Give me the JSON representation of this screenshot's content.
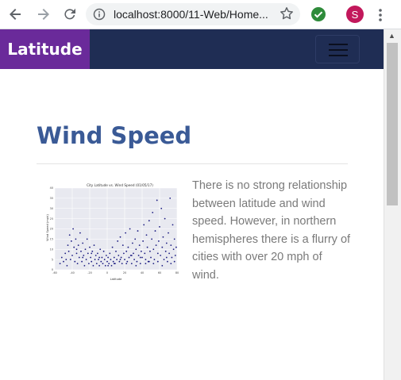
{
  "browser": {
    "url": "localhost:8000/11-Web/Home...",
    "avatar_letter": "S",
    "icons": [
      "back-arrow-icon",
      "forward-arrow-icon",
      "reload-icon",
      "info-icon",
      "star-icon",
      "check-extension-icon",
      "kebab-menu-icon"
    ]
  },
  "navbar": {
    "brand": "Latitude",
    "brand_color": "#6a2a9a",
    "background_color": "#1f2d54"
  },
  "main": {
    "title": "Wind Speed",
    "title_color": "#3a5a96",
    "description": "There is no strong relationship between latitude and wind speed. However, in northern hemispheres there is a flurry of cities with over 20 mph of wind."
  },
  "chart_data": {
    "type": "scatter",
    "title": "City Latitude vs. Wind Speed (01/05/17)",
    "xlabel": "Latitude",
    "ylabel": "Wind Speed (mph)",
    "xlim": [
      -60,
      80
    ],
    "ylim": [
      0,
      40
    ],
    "xticks": [
      "-60",
      "-40",
      "-20",
      "0",
      "20",
      "40",
      "60",
      "80"
    ],
    "yticks": [
      "0",
      "5",
      "10",
      "15",
      "20",
      "25",
      "30",
      "35",
      "40"
    ],
    "grid": true,
    "point_color": "#1a1a80",
    "series": [
      {
        "points": [
          [
            -54,
            3
          ],
          [
            -52,
            6
          ],
          [
            -50,
            4
          ],
          [
            -48,
            8
          ],
          [
            -46,
            2
          ],
          [
            -45,
            12
          ],
          [
            -44,
            9
          ],
          [
            -43,
            17
          ],
          [
            -42,
            5
          ],
          [
            -41,
            14
          ],
          [
            -40,
            7
          ],
          [
            -39,
            20
          ],
          [
            -38,
            11
          ],
          [
            -37,
            4
          ],
          [
            -36,
            15
          ],
          [
            -35,
            8
          ],
          [
            -34,
            3
          ],
          [
            -33,
            12
          ],
          [
            -32,
            6
          ],
          [
            -31,
            18
          ],
          [
            -30,
            9
          ],
          [
            -29,
            4
          ],
          [
            -28,
            13
          ],
          [
            -27,
            7
          ],
          [
            -26,
            2
          ],
          [
            -25,
            10
          ],
          [
            -24,
            5
          ],
          [
            -23,
            15
          ],
          [
            -22,
            8
          ],
          [
            -21,
            3
          ],
          [
            -20,
            11
          ],
          [
            -19,
            6
          ],
          [
            -18,
            4
          ],
          [
            -17,
            9
          ],
          [
            -16,
            2
          ],
          [
            -15,
            12
          ],
          [
            -14,
            5
          ],
          [
            -13,
            7
          ],
          [
            -12,
            3
          ],
          [
            -11,
            8
          ],
          [
            -10,
            5
          ],
          [
            -9,
            2
          ],
          [
            -8,
            10
          ],
          [
            -7,
            4
          ],
          [
            -6,
            6
          ],
          [
            -5,
            3
          ],
          [
            -4,
            9
          ],
          [
            -3,
            5
          ],
          [
            -2,
            2
          ],
          [
            -1,
            7
          ],
          [
            0,
            4
          ],
          [
            1,
            6
          ],
          [
            2,
            3
          ],
          [
            3,
            8
          ],
          [
            4,
            5
          ],
          [
            5,
            2
          ],
          [
            6,
            11
          ],
          [
            7,
            4
          ],
          [
            8,
            6
          ],
          [
            9,
            3
          ],
          [
            10,
            9
          ],
          [
            11,
            5
          ],
          [
            12,
            14
          ],
          [
            13,
            7
          ],
          [
            14,
            4
          ],
          [
            15,
            16
          ],
          [
            16,
            6
          ],
          [
            17,
            3
          ],
          [
            18,
            12
          ],
          [
            19,
            8
          ],
          [
            20,
            5
          ],
          [
            21,
            18
          ],
          [
            22,
            9
          ],
          [
            23,
            4
          ],
          [
            24,
            11
          ],
          [
            25,
            6
          ],
          [
            26,
            20
          ],
          [
            27,
            7
          ],
          [
            28,
            3
          ],
          [
            29,
            13
          ],
          [
            30,
            8
          ],
          [
            31,
            5
          ],
          [
            32,
            15
          ],
          [
            33,
            10
          ],
          [
            34,
            4
          ],
          [
            35,
            19
          ],
          [
            36,
            7
          ],
          [
            37,
            12
          ],
          [
            38,
            3
          ],
          [
            39,
            9
          ],
          [
            40,
            6
          ],
          [
            41,
            14
          ],
          [
            42,
            22
          ],
          [
            43,
            8
          ],
          [
            44,
            5
          ],
          [
            45,
            17
          ],
          [
            46,
            11
          ],
          [
            47,
            4
          ],
          [
            48,
            24
          ],
          [
            49,
            9
          ],
          [
            50,
            6
          ],
          [
            51,
            15
          ],
          [
            52,
            28
          ],
          [
            53,
            10
          ],
          [
            54,
            5
          ],
          [
            55,
            19
          ],
          [
            56,
            12
          ],
          [
            57,
            34
          ],
          [
            58,
            8
          ],
          [
            59,
            14
          ],
          [
            60,
            21
          ],
          [
            61,
            7
          ],
          [
            62,
            30
          ],
          [
            63,
            11
          ],
          [
            64,
            16
          ],
          [
            65,
            5
          ],
          [
            66,
            25
          ],
          [
            67,
            9
          ],
          [
            68,
            13
          ],
          [
            69,
            4
          ],
          [
            70,
            18
          ],
          [
            71,
            8
          ],
          [
            72,
            35
          ],
          [
            73,
            12
          ],
          [
            74,
            6
          ],
          [
            75,
            22
          ],
          [
            76,
            10
          ],
          [
            77,
            15
          ],
          [
            78,
            7
          ],
          [
            79,
            11
          ],
          [
            -47,
            5
          ],
          [
            -35,
            10
          ],
          [
            -28,
            6
          ],
          [
            -18,
            8
          ],
          [
            -9,
            6
          ],
          [
            1,
            2
          ],
          [
            8,
            3
          ],
          [
            15,
            5
          ],
          [
            22,
            3
          ],
          [
            28,
            7
          ],
          [
            33,
            2
          ],
          [
            38,
            6
          ],
          [
            44,
            3
          ],
          [
            48,
            4
          ],
          [
            53,
            3
          ],
          [
            58,
            4
          ],
          [
            63,
            2
          ],
          [
            68,
            6
          ],
          [
            73,
            3
          ],
          [
            77,
            4
          ]
        ]
      }
    ]
  }
}
